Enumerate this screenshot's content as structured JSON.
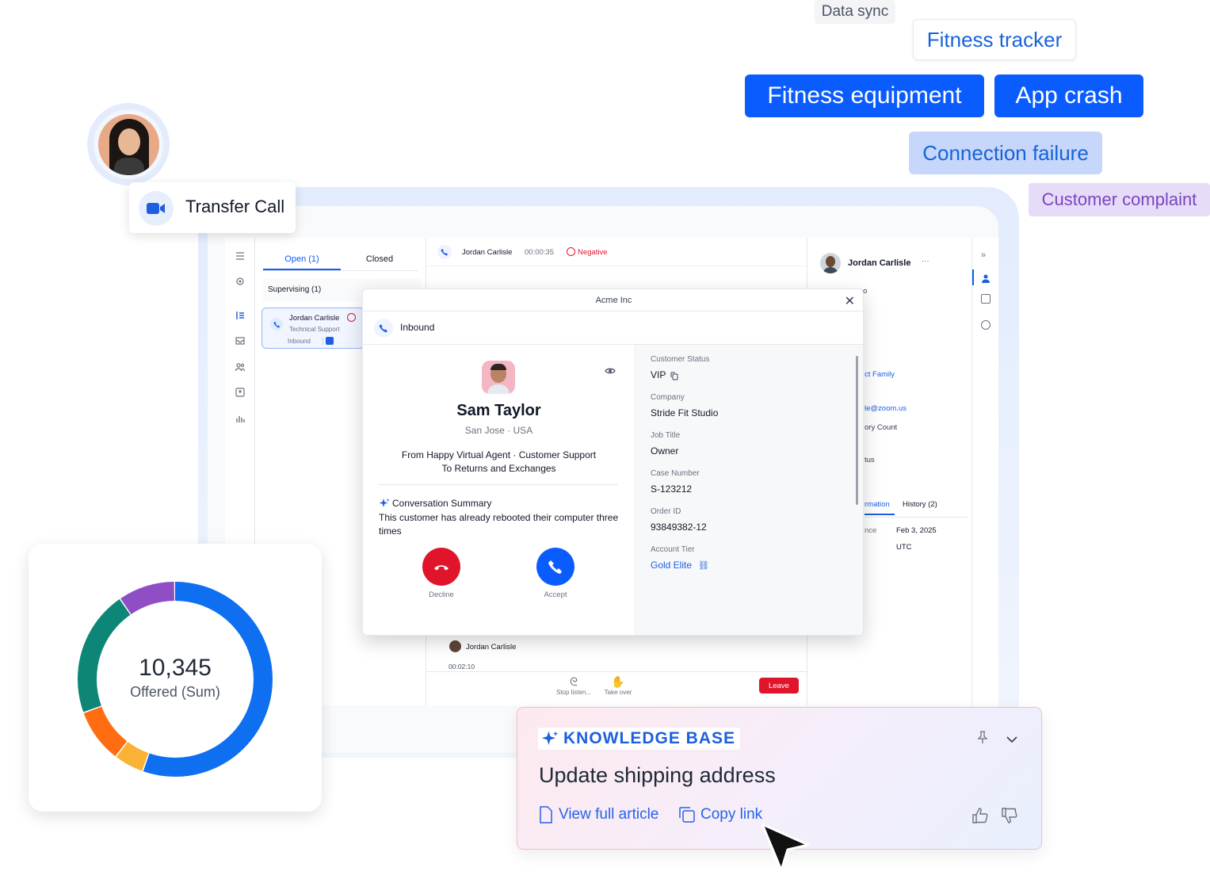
{
  "tags": {
    "data_sync": "Data sync",
    "fitness_tracker": "Fitness tracker",
    "fitness_equipment": "Fitness equipment",
    "app_crash": "App crash",
    "connection_failure": "Connection failure",
    "customer_complaint": "Customer complaint"
  },
  "transfer": {
    "label": "Transfer Call"
  },
  "queue": {
    "tab_open": "Open (1)",
    "tab_closed": "Closed",
    "section": "Supervising (1)",
    "card": {
      "name": "Jordan Carlisle",
      "team": "Technical Support",
      "direction": "Inbound"
    }
  },
  "call_bar": {
    "name": "Jordan Carlisle",
    "timer": "00:00:35",
    "sentiment": "Negative"
  },
  "bottom_bar": {
    "name": "Jordan Carlisle",
    "timer": "00:02:10",
    "stop_listen": "Stop listen...",
    "take_over": "Take over",
    "leave": "Leave"
  },
  "side_panel": {
    "name": "Jordan Carlisle",
    "more": "···",
    "frag_family": "ct Family",
    "frag_email": "le@zoom.us",
    "frag_count": "ory Count",
    "frag_status": "tus",
    "tab_info": "rmation",
    "tab_history": "History (2)",
    "frag_since": "nce",
    "date": "Feb 3, 2025",
    "tz": "UTC",
    "frag_top": "o"
  },
  "modal": {
    "title": "Acme Inc",
    "direction": "Inbound",
    "customer_name": "Sam Taylor",
    "city": "San Jose",
    "country": "· USA",
    "route_line1": "From Happy Virtual Agent · Customer Support",
    "route_line2": "To Returns and Exchanges",
    "summary_title": "Conversation Summary",
    "summary_text": "This customer has already rebooted their computer three times",
    "decline": "Decline",
    "accept": "Accept",
    "fields": [
      {
        "label": "Customer Status",
        "value": "VIP"
      },
      {
        "label": "Company",
        "value": "Stride Fit Studio"
      },
      {
        "label": "Job Title",
        "value": "Owner"
      },
      {
        "label": "Case Number",
        "value": "S-123212"
      },
      {
        "label": "Order ID",
        "value": "93849382-12"
      },
      {
        "label": "Account Tier",
        "value": "Gold Elite"
      }
    ]
  },
  "donut": {
    "value": "10,345",
    "label": "Offered (Sum)",
    "segments": [
      {
        "color": "#0e6ff0",
        "fraction": 0.555
      },
      {
        "color": "#f9b233",
        "fraction": 0.05
      },
      {
        "color": "#ff6d12",
        "fraction": 0.09
      },
      {
        "color": "#0d8577",
        "fraction": 0.21
      },
      {
        "color": "#8f4ec4",
        "fraction": 0.095
      }
    ]
  },
  "knowledge_base": {
    "badge": "KNOWLEDGE BASE",
    "title": "Update shipping address",
    "view_article": "View full article",
    "copy_link": "Copy link"
  },
  "colors": {
    "brand": "#0b5cff",
    "danger": "#e0152c"
  }
}
